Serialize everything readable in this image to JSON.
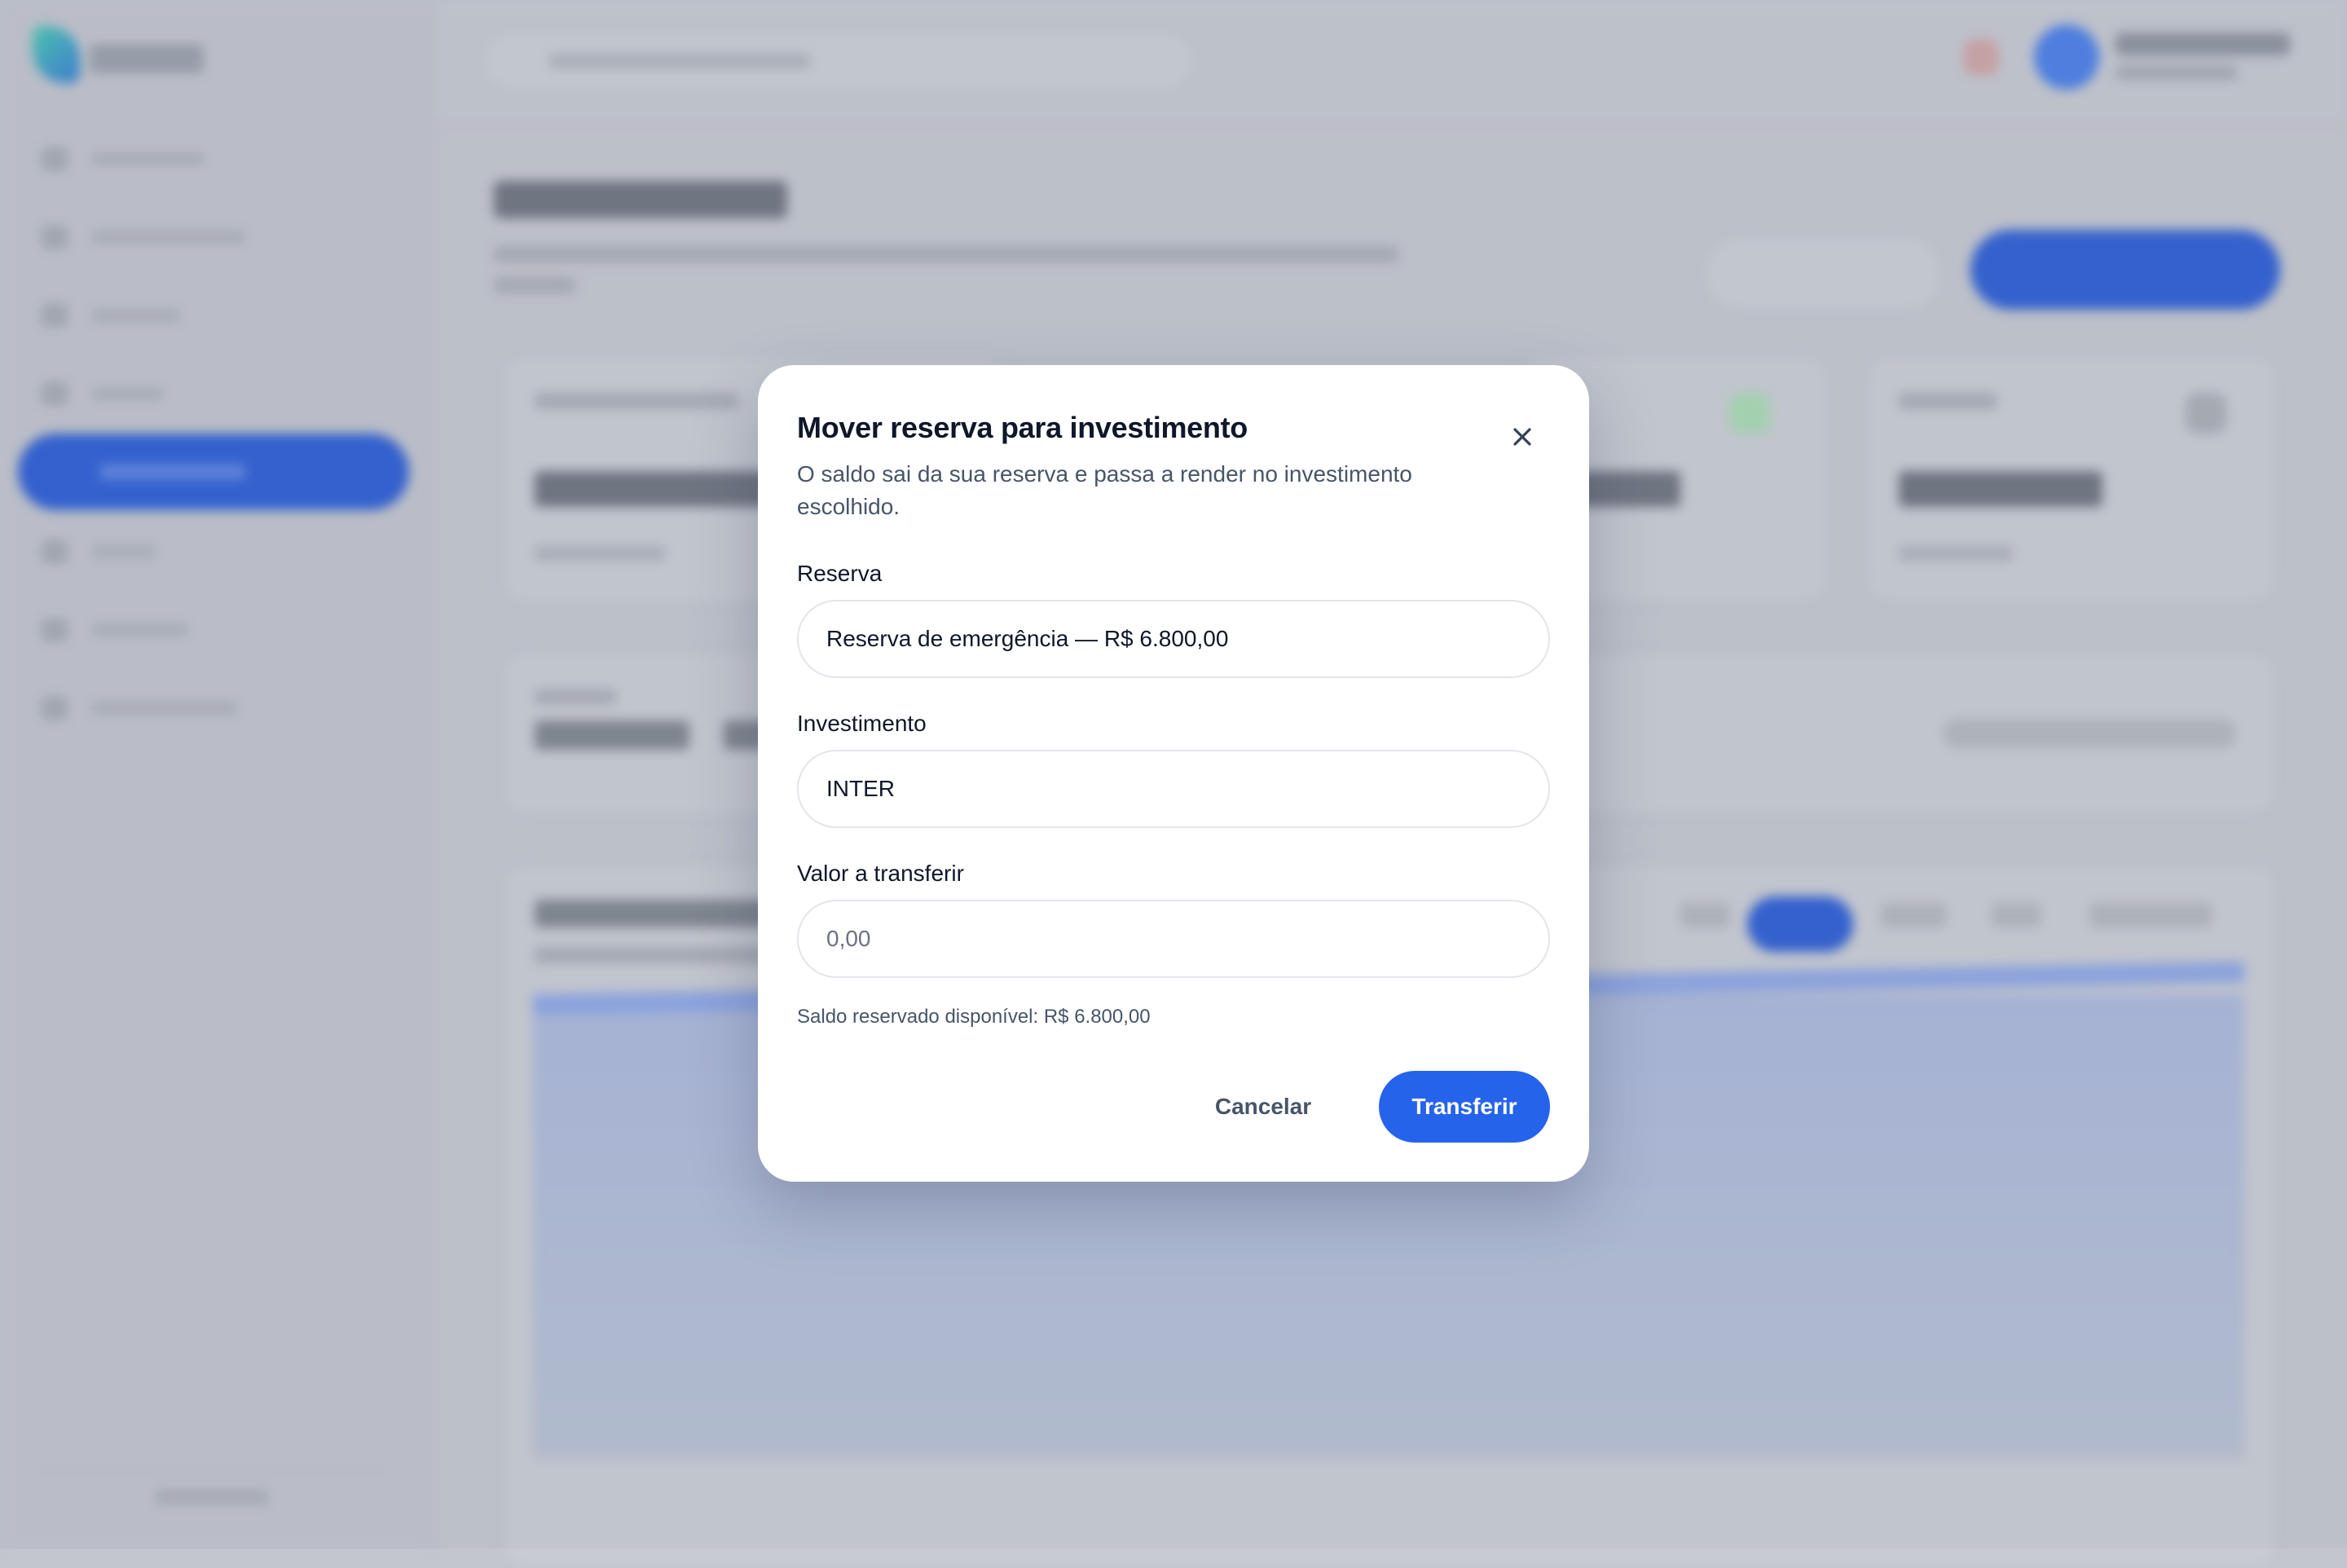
{
  "modal": {
    "title": "Mover reserva para investimento",
    "description": "O saldo sai da sua reserva e passa a render no investimento escolhido.",
    "reserve": {
      "label": "Reserva",
      "value": "Reserva de emergência — R$ 6.800,00"
    },
    "investment": {
      "label": "Investimento",
      "value": "INTER"
    },
    "amount": {
      "label": "Valor a transferir",
      "placeholder": "0,00"
    },
    "available_hint": "Saldo reservado disponível: R$ 6.800,00",
    "cancel_label": "Cancelar",
    "submit_label": "Transferir"
  },
  "colors": {
    "primary": "#2563eb",
    "title": "#0f172a",
    "muted": "#475569",
    "border": "#e2e5ea"
  },
  "icons": {
    "close": "close-icon"
  }
}
